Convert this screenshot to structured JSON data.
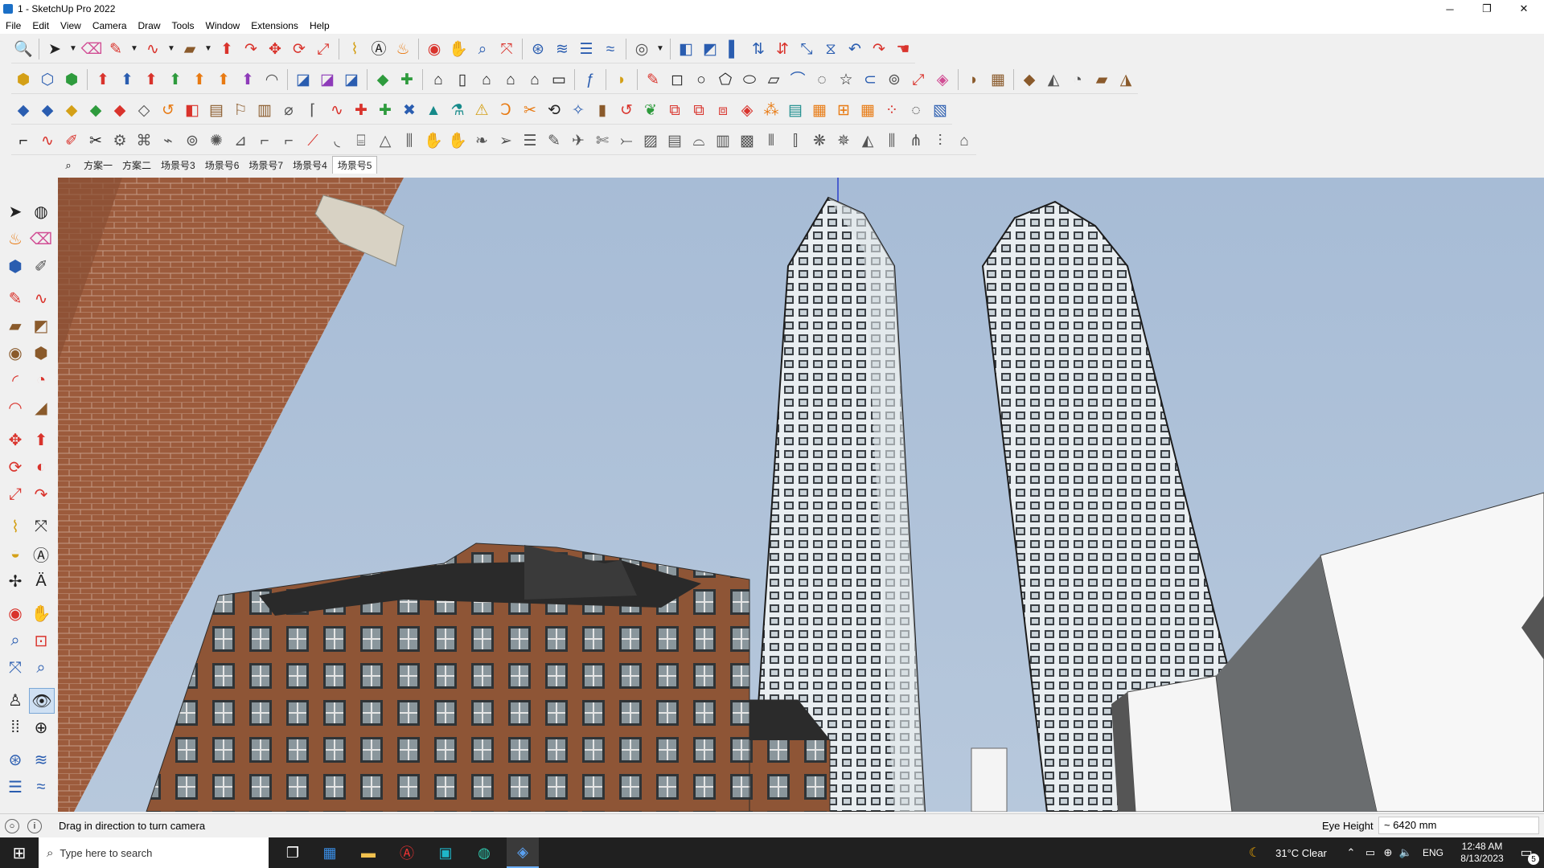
{
  "window": {
    "title": "1 - SketchUp Pro 2022",
    "minimize_glyph": "─",
    "restore_glyph": "❐",
    "close_glyph": "✕"
  },
  "menu": [
    "File",
    "Edit",
    "View",
    "Camera",
    "Draw",
    "Tools",
    "Window",
    "Extensions",
    "Help"
  ],
  "scene_tabs": [
    {
      "label": "方案一",
      "active": false
    },
    {
      "label": "方案二",
      "active": false
    },
    {
      "label": "场景号3",
      "active": false
    },
    {
      "label": "场景号6",
      "active": false
    },
    {
      "label": "场景号7",
      "active": false
    },
    {
      "label": "场景号4",
      "active": false
    },
    {
      "label": "场景号5",
      "active": true
    }
  ],
  "status": {
    "message": "Drag in direction to turn camera",
    "measurement_label": "Eye Height",
    "measurement_value": "~ 6420 mm"
  },
  "taskbar": {
    "search_placeholder": "Type here to search",
    "weather": "31°C  Clear",
    "language": "ENG",
    "time": "12:48 AM",
    "date": "8/13/2023",
    "notification_count": "5"
  },
  "icons": {
    "row1": [
      "zoom-icon",
      "select-icon",
      "dropdown",
      "eraser-icon",
      "pencil-icon",
      "dropdown",
      "freehand-icon",
      "dropdown",
      "rectangle-icon",
      "dropdown",
      "pushpull-icon",
      "followme-icon",
      "move-icon",
      "rotate-icon",
      "scale-icon",
      "tape-icon",
      "text-icon",
      "paint-icon",
      "orbit-icon",
      "pan-icon",
      "zoom-window-icon",
      "zoom-extents-icon",
      "warehouse-icon",
      "layers-icon",
      "tags-icon",
      "styles-icon",
      "account-icon",
      "dropdown",
      "component-icon",
      "material-icon",
      "section-icon",
      "up-icon",
      "down-icon",
      "measure-icon",
      "extension-icon",
      "undo-icon",
      "redo-icon",
      "hand-icon"
    ],
    "row2": [
      "iso-view-icon",
      "top-view-icon",
      "front-view-icon",
      "solid-union-icon",
      "solid-subtract-icon",
      "solid-intersect-icon",
      "solid-trim-icon",
      "solid-split-icon",
      "solid-outer-icon",
      "solid-shell-icon",
      "arc-icon",
      "edit-icon",
      "section-fill-icon",
      "section-display-icon",
      "terrain-icon",
      "stamp-icon",
      "house-icon",
      "wall-icon",
      "home-icon",
      "roof-icon",
      "garage-icon",
      "function-icon",
      "tag-shape-icon",
      "ruler-icon",
      "circle-icon",
      "circle-icon",
      "circle-icon",
      "polygon-icon",
      "ellipse-icon",
      "parallelogram-icon",
      "curve-icon",
      "spiral-icon",
      "star-icon",
      "loop-icon",
      "spring-icon",
      "flip-icon",
      "pink-eraser-icon",
      "box-icon",
      "grid-icon",
      "surface-icon",
      "mesh-icon",
      "drape-icon",
      "patch-icon",
      "fill-icon"
    ],
    "row3": [
      "blue-plane-icon",
      "blue-plane-icon",
      "yellow-plane-icon",
      "green-plane-icon",
      "red-plane-icon",
      "white-plane-icon",
      "orange-arc-icon",
      "red-square-icon",
      "panel-icon",
      "flag-icon",
      "brick-icon",
      "pipe-icon",
      "curve-tool-icon",
      "bezier-icon",
      "cross-icon",
      "plus-icon",
      "cancel-icon",
      "cone-icon",
      "flask-icon",
      "warning-icon",
      "hook-icon",
      "fork-icon",
      "circle-arrow-icon",
      "node-icon",
      "trash-icon",
      "undo-red-icon",
      "leaf-icon",
      "divide-icon",
      "split-icon",
      "component-small-icon",
      "gem-icon",
      "network-icon",
      "calendar-icon",
      "orange-grid-icon",
      "orange-grid-icon",
      "orange-grid-icon",
      "scatter-icon",
      "curve-dots-icon",
      "grid-small-icon"
    ],
    "row4": [
      "polyline-icon",
      "spline-icon",
      "brush-icon",
      "scissor-icon",
      "gear-icon",
      "puzzle-icon",
      "pipe-icon",
      "shell-icon",
      "cog-icon",
      "slice-icon",
      "corner-icon",
      "corner-icon",
      "edge-icon",
      "round-icon",
      "cylinder-icon",
      "cone-outline-icon",
      "bars-icon",
      "hand-icon",
      "mittens-icon",
      "leaf-icon",
      "arrow-icon",
      "stairs-icon",
      "pencil-gray-icon",
      "plane-icon",
      "trim-icon",
      "extend-icon",
      "hatch-icon",
      "stack-icon",
      "bridge-icon",
      "tube-icon",
      "grid-icon",
      "fence-icon",
      "ornament-icon",
      "ornament-icon",
      "ornament-icon",
      "ornament-icon",
      "bars-icon",
      "arch-icon",
      "column-icon",
      "house-outline-icon"
    ],
    "left": [
      "select-icon",
      "orbit-icon",
      "paint-bucket-icon",
      "eraser-icon",
      "component-icon",
      "pencil-icon",
      "line-icon",
      "freehand-icon",
      "rectangle-icon",
      "rotated-rect-icon",
      "circle-icon",
      "polygon-icon",
      "arc-icon",
      "pie-icon",
      "arc2-icon",
      "arc3-icon",
      "move-icon",
      "pushpull-icon",
      "rotate-icon",
      "followme-icon",
      "scale-icon",
      "offset-icon",
      "tape-icon",
      "dimension-icon",
      "protractor-icon",
      "text-icon",
      "axes-icon",
      "3dtext-icon",
      "orbit-icon",
      "pan-icon",
      "zoom-icon",
      "zoom-window-icon",
      "zoom-extents-icon",
      "previous-view-icon",
      "walk-icon",
      "look-around-icon",
      "position-camera-icon",
      "footsteps-icon",
      "section-icon",
      "warehouse-icon",
      "layers-icon",
      "stack-icon"
    ]
  },
  "colors": {
    "sky_top": "#a6bbd5",
    "sky_bottom": "#b8c9dc",
    "brick": "#9a5a3a",
    "tower_line": "#202020",
    "taskbar": "#202020"
  }
}
